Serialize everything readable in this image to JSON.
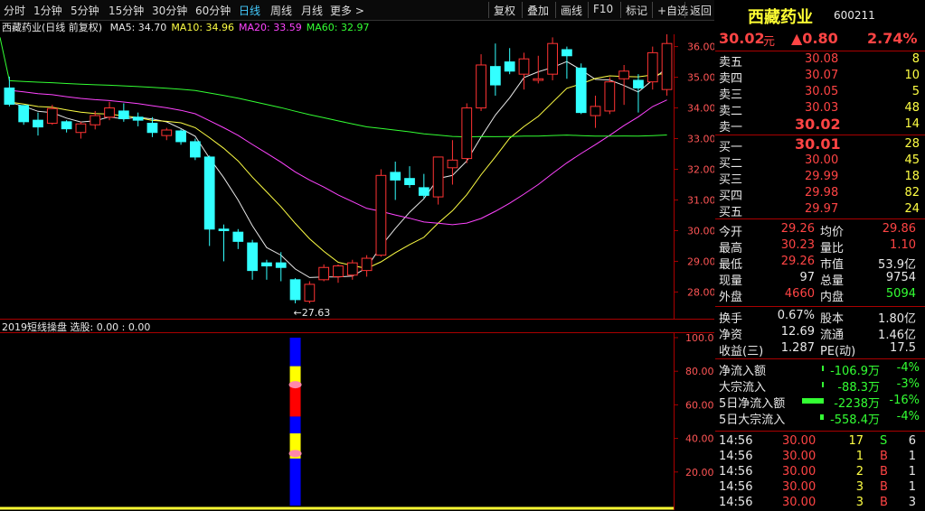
{
  "toolbar": {
    "periods": [
      "分时",
      "1分钟",
      "5分钟",
      "15分钟",
      "30分钟",
      "60分钟",
      "日线",
      "周线",
      "月线",
      "更多 >"
    ],
    "active_period": "日线",
    "buttons": [
      "复权",
      "叠加",
      "画线",
      "F10",
      "标记",
      "+自选",
      "返回"
    ]
  },
  "ma_header": {
    "title": "西藏药业(日线 前复权)",
    "items": [
      {
        "label": "MA5: 34.70",
        "color": "#e8e8e8"
      },
      {
        "label": "MA10: 34.96",
        "color": "#ffff44"
      },
      {
        "label": "MA20: 33.59",
        "color": "#ff44ff"
      },
      {
        "label": "MA60: 32.97",
        "color": "#33ff33"
      }
    ]
  },
  "main_chart": {
    "price_ticks": [
      "36.00",
      "35.00",
      "34.00",
      "33.00",
      "32.00",
      "31.00",
      "30.00",
      "29.00",
      "28.00"
    ],
    "high_label": "36.47",
    "low_label": "27.63",
    "candles": [
      [
        34.65,
        35.02,
        34.05,
        34.12
      ],
      [
        34.08,
        34.05,
        33.45,
        33.55
      ],
      [
        33.6,
        33.85,
        33.1,
        33.38
      ],
      [
        33.5,
        34.1,
        33.45,
        33.98
      ],
      [
        33.55,
        33.6,
        33.2,
        33.32
      ],
      [
        33.2,
        33.55,
        33.0,
        33.48
      ],
      [
        33.45,
        33.9,
        33.3,
        33.75
      ],
      [
        33.7,
        34.2,
        33.6,
        34.0
      ],
      [
        33.9,
        34.15,
        33.55,
        33.65
      ],
      [
        33.7,
        33.85,
        33.4,
        33.6
      ],
      [
        33.5,
        33.7,
        33.05,
        33.2
      ],
      [
        33.1,
        33.35,
        32.95,
        33.28
      ],
      [
        33.25,
        33.3,
        32.8,
        32.9
      ],
      [
        32.9,
        33.0,
        32.3,
        32.4
      ],
      [
        32.4,
        32.45,
        29.5,
        30.05
      ],
      [
        30.05,
        30.2,
        29.0,
        30.0
      ],
      [
        29.95,
        30.05,
        29.4,
        29.65
      ],
      [
        29.6,
        29.7,
        28.4,
        28.7
      ],
      [
        28.95,
        29.05,
        28.4,
        28.85
      ],
      [
        28.95,
        29.3,
        28.35,
        28.8
      ],
      [
        28.4,
        28.45,
        27.63,
        27.75
      ],
      [
        27.7,
        28.35,
        27.63,
        28.25
      ],
      [
        28.4,
        28.9,
        28.35,
        28.8
      ],
      [
        28.5,
        28.9,
        28.3,
        28.85
      ],
      [
        28.55,
        29.05,
        28.4,
        28.95
      ],
      [
        28.7,
        29.2,
        28.5,
        29.1
      ],
      [
        29.2,
        32.0,
        29.15,
        31.8
      ],
      [
        31.9,
        32.25,
        31.0,
        31.65
      ],
      [
        31.7,
        32.1,
        31.4,
        31.5
      ],
      [
        31.4,
        31.85,
        31.05,
        31.15
      ],
      [
        31.1,
        32.4,
        30.85,
        32.4
      ],
      [
        32.05,
        32.95,
        31.5,
        32.3
      ],
      [
        32.35,
        34.15,
        32.2,
        34.0
      ],
      [
        34.0,
        35.75,
        33.9,
        35.4
      ],
      [
        35.35,
        36.1,
        34.4,
        34.75
      ],
      [
        35.5,
        35.95,
        35.1,
        35.2
      ],
      [
        35.1,
        35.8,
        34.6,
        35.6
      ],
      [
        34.9,
        35.7,
        34.8,
        34.95
      ],
      [
        35.1,
        36.3,
        34.9,
        36.1
      ],
      [
        35.9,
        36.0,
        34.95,
        35.7
      ],
      [
        35.3,
        35.45,
        33.8,
        33.85
      ],
      [
        33.75,
        34.4,
        33.35,
        34.05
      ],
      [
        33.9,
        35.0,
        33.8,
        34.85
      ],
      [
        34.95,
        35.4,
        34.1,
        35.2
      ],
      [
        34.9,
        35.1,
        33.85,
        34.65
      ],
      [
        34.85,
        36.0,
        34.6,
        35.8
      ],
      [
        34.6,
        36.47,
        34.4,
        36.1
      ]
    ]
  },
  "indicator": {
    "title": "2019短线操盘 选股: 0.00 : 0.00",
    "ticks": [
      "100.00",
      "80.00",
      "60.00",
      "40.00",
      "20.00"
    ]
  },
  "quote": {
    "name": "西藏药业",
    "code": "600211",
    "price": "30.02",
    "price_unit": "元",
    "change": "▲0.80",
    "change_pct": "2.74%",
    "asks": [
      {
        "label": "卖五",
        "price": "30.08",
        "vol": "8"
      },
      {
        "label": "卖四",
        "price": "30.07",
        "vol": "10"
      },
      {
        "label": "卖三",
        "price": "30.05",
        "vol": "5"
      },
      {
        "label": "卖二",
        "price": "30.03",
        "vol": "48"
      },
      {
        "label": "卖一",
        "price": "30.02",
        "vol": "14"
      }
    ],
    "bids": [
      {
        "label": "买一",
        "price": "30.01",
        "vol": "28"
      },
      {
        "label": "买二",
        "price": "30.00",
        "vol": "45"
      },
      {
        "label": "买三",
        "price": "29.99",
        "vol": "18"
      },
      {
        "label": "买四",
        "price": "29.98",
        "vol": "82"
      },
      {
        "label": "买五",
        "price": "29.97",
        "vol": "24"
      }
    ],
    "stats": [
      {
        "k1": "今开",
        "v1": "29.26",
        "c1": "#ff4444",
        "k2": "均价",
        "v2": "29.86",
        "c2": "#ff4444"
      },
      {
        "k1": "最高",
        "v1": "30.23",
        "c1": "#ff4444",
        "k2": "量比",
        "v2": "1.10",
        "c2": "#ff4444"
      },
      {
        "k1": "最低",
        "v1": "29.26",
        "c1": "#ff4444",
        "k2": "市值",
        "v2": "53.9亿",
        "c2": "#e8e8e8"
      },
      {
        "k1": "现量",
        "v1": "97",
        "c1": "#e8e8e8",
        "k2": "总量",
        "v2": "9754",
        "c2": "#e8e8e8"
      },
      {
        "k1": "外盘",
        "v1": "4660",
        "c1": "#ff4444",
        "k2": "内盘",
        "v2": "5094",
        "c2": "#33ff33"
      }
    ],
    "stats2": [
      {
        "k1": "换手",
        "v1": "0.67%",
        "k2": "股本",
        "v2": "1.80亿"
      },
      {
        "k1": "净资",
        "v1": "12.69",
        "k2": "流通",
        "v2": "1.46亿"
      },
      {
        "k1": "收益(三)",
        "v1": "1.287",
        "k2": "PE(动)",
        "v2": "17.5"
      }
    ],
    "flows": [
      {
        "label": "净流入额",
        "value": "-106.9万",
        "pct": "-4%",
        "bar": 2
      },
      {
        "label": "大宗流入",
        "value": "-88.3万",
        "pct": "-3%",
        "bar": 2
      },
      {
        "label": "5日净流入额",
        "value": "-2238万",
        "pct": "-16%",
        "bar": 24
      },
      {
        "label": "5日大宗流入",
        "value": "-558.4万",
        "pct": "-4%",
        "bar": 4
      }
    ],
    "ticks": [
      {
        "time": "14:56",
        "price": "30.00",
        "vol": "17",
        "side": "S",
        "num": "6",
        "side_color": "#33ff33"
      },
      {
        "time": "14:56",
        "price": "30.00",
        "vol": "1",
        "side": "B",
        "num": "1",
        "side_color": "#ff4444"
      },
      {
        "time": "14:56",
        "price": "30.00",
        "vol": "2",
        "side": "B",
        "num": "1",
        "side_color": "#ff4444"
      },
      {
        "time": "14:56",
        "price": "30.00",
        "vol": "3",
        "side": "B",
        "num": "1",
        "side_color": "#ff4444"
      },
      {
        "time": "14:56",
        "price": "30.00",
        "vol": "3",
        "side": "B",
        "num": "3",
        "side_color": "#ff4444"
      }
    ]
  }
}
